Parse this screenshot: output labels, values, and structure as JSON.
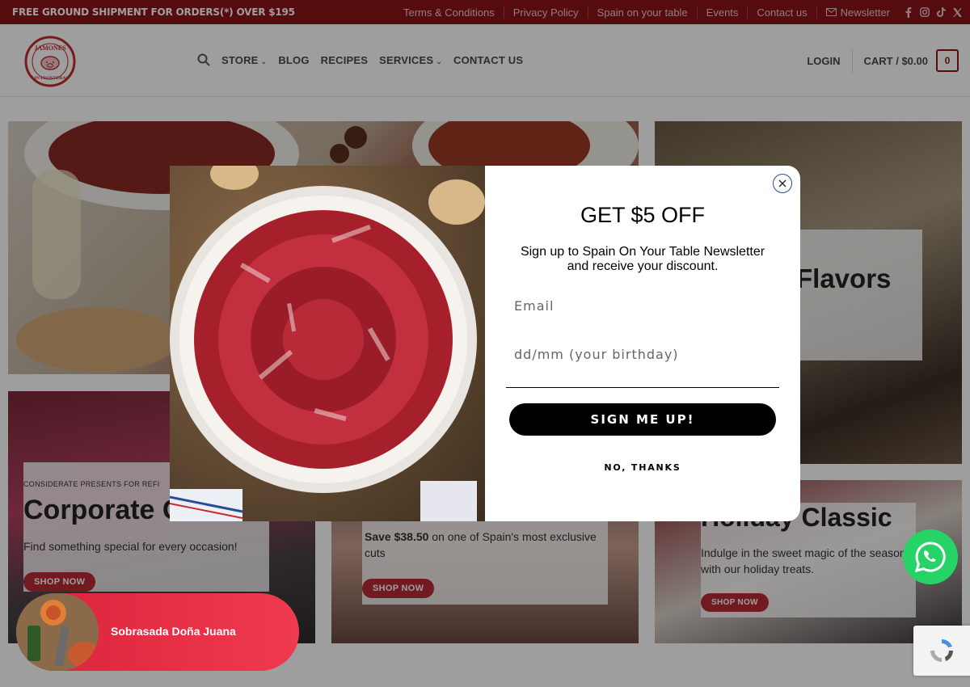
{
  "topbar": {
    "shipping": "FREE GROUND SHIPMENT FOR ORDERS(*) OVER $195",
    "links": [
      "Terms & Conditions",
      "Privacy Policy",
      "Spain on your table",
      "Events",
      "Contact us"
    ],
    "newsletter": "Newsletter",
    "social_icons": [
      "facebook-icon",
      "instagram-icon",
      "tiktok-icon",
      "x-icon"
    ]
  },
  "header": {
    "logo_text_top": "JAMONES",
    "logo_text_bottom": "SIN FRONTERAS",
    "nav": [
      {
        "label": "STORE",
        "dropdown": true
      },
      {
        "label": "BLOG",
        "dropdown": false
      },
      {
        "label": "RECIPES",
        "dropdown": false
      },
      {
        "label": "SERVICES",
        "dropdown": true
      },
      {
        "label": "CONTACT US",
        "dropdown": false
      }
    ],
    "login": "LOGIN",
    "cart_label": "CART / $0.00",
    "cart_count": "0"
  },
  "banners": {
    "flavors_title": "Flavors",
    "corporate_eyebrow": "CONSIDERATE PRESENTS FOR REFI",
    "corporate_title": "Corporate G",
    "corporate_title_tail": "g",
    "corporate_text": "Find something special for every occasion!",
    "corporate_button": "SHOP NOW",
    "save_bold": "Save $38.50",
    "save_text": " on one of Spain's most exclusive cuts",
    "save_button": "SHOP NOW",
    "holiday_title": "Holiday Classic",
    "holiday_text": "Indulge in the sweet magic of the season with our holiday treats.",
    "holiday_button": "SHOP NOW"
  },
  "modal": {
    "title": "GET $5 OFF",
    "subtitle": "Sign up to Spain On Your Table Newsletter and receive your discount.",
    "email_placeholder": "Email",
    "birthday_placeholder": "dd/mm (your birthday)",
    "submit": "SIGN ME UP!",
    "decline": "NO, THANKS"
  },
  "promo": {
    "product": "Sobrasada Doña Juana"
  },
  "colors": {
    "brand": "#8c1218",
    "accent_button": "#b72a34",
    "promo": "#e42c42",
    "whatsapp": "#25d366"
  }
}
